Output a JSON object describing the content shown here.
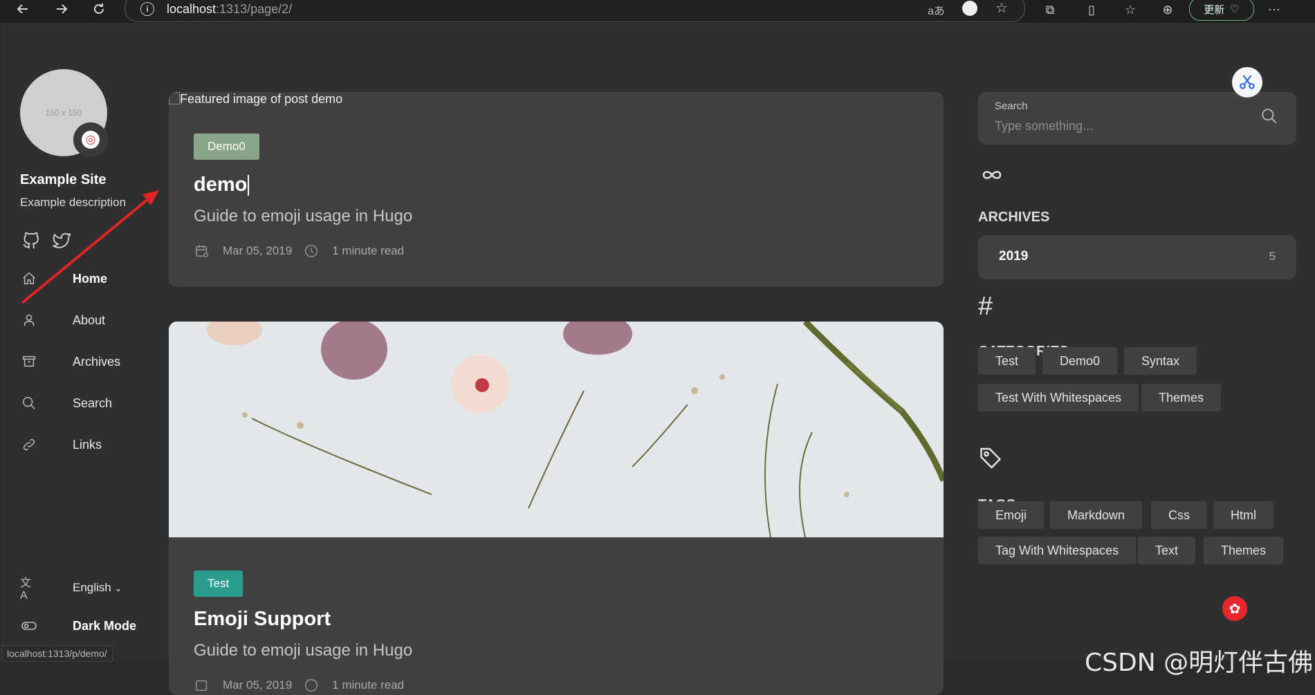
{
  "browser": {
    "url_host": "localhost",
    "url_rest": ":1313/page/2/",
    "update_label": "更新",
    "status_url": "localhost:1313/p/demo/"
  },
  "sidebar": {
    "avatar_placeholder": "150 x 150",
    "site_name": "Example Site",
    "site_description": "Example description",
    "menu": [
      {
        "label": "Home",
        "icon": "home-icon",
        "active": true
      },
      {
        "label": "About",
        "icon": "user-icon",
        "active": false
      },
      {
        "label": "Archives",
        "icon": "archive-icon",
        "active": false
      },
      {
        "label": "Search",
        "icon": "search-icon",
        "active": false
      },
      {
        "label": "Links",
        "icon": "link-icon",
        "active": false
      }
    ],
    "language": "English",
    "dark_mode_label": "Dark Mode"
  },
  "posts": [
    {
      "image_alt": "Featured image of post demo",
      "category": "Demo0",
      "category_color": "#8aa68a",
      "title": "demo",
      "subtitle": "Guide to emoji usage in Hugo",
      "date": "Mar 05, 2019",
      "read_time": "1 minute read"
    },
    {
      "category": "Test",
      "category_color": "#2a9d8f",
      "title": "Emoji Support",
      "subtitle": "Guide to emoji usage in Hugo",
      "date": "Mar 05, 2019",
      "read_time": "1 minute read"
    }
  ],
  "search": {
    "label": "Search",
    "placeholder": "Type something..."
  },
  "archives": {
    "title": "ARCHIVES",
    "year": "2019",
    "count": "5"
  },
  "categories": {
    "title": "CATEGORIES",
    "items": [
      "Test",
      "Demo0",
      "Syntax",
      "Test With Whitespaces",
      "Themes"
    ]
  },
  "tags": {
    "title": "TAGS",
    "items": [
      "Emoji",
      "Markdown",
      "Css",
      "Html",
      "Tag With Whitespaces",
      "Text",
      "Themes"
    ]
  },
  "watermark": "CSDN @明灯伴古佛"
}
